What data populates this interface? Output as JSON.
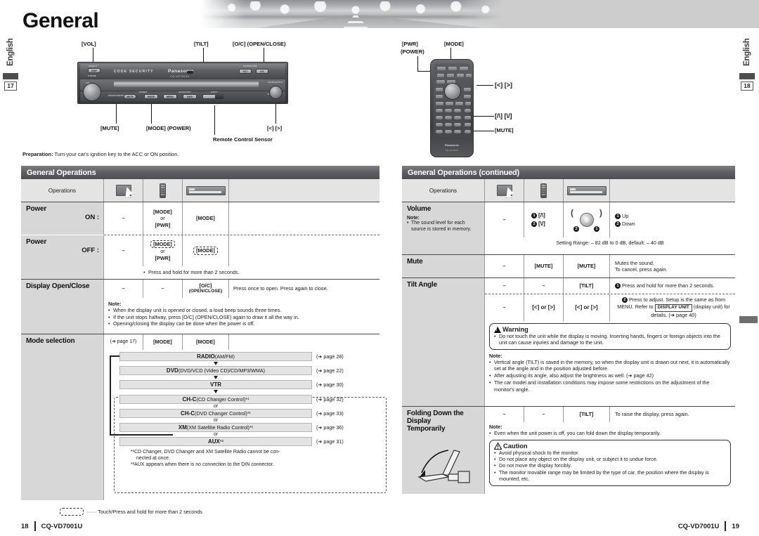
{
  "document": {
    "title": "General",
    "language_tab": "English",
    "left_page_number": "17",
    "right_page_number": "18",
    "footer_left_page": "18",
    "footer_left_model": "CQ-VD7001U",
    "footer_right_page": "19",
    "footer_right_model": "CQ-VD7001U"
  },
  "unit_callouts": {
    "vol": "[VOL]",
    "tilt": "[TILT]",
    "open_close": "[O/C] (OPEN/CLOSE)",
    "mute": "[MUTE]",
    "mode_power": "[MODE] (POWER)",
    "left_right": "[<] [>]",
    "remote_sensor": "Remote Control Sensor",
    "brand": "Panasonic",
    "model": "CQ-VD7001U",
    "code_security": "CODE SECURITY",
    "aspect": "ASPECT",
    "p_mode": "P-MODE",
    "disp": "DISP",
    "tilt_btn": "TILT",
    "oc_btn": "O/C",
    "open_close_small": "OPEN/CLOSE",
    "source_signal": "SOURCE/SIGNAL",
    "mute_btn": "MUTE",
    "power_small": "POWER",
    "mode_btn": "MODE",
    "menu_btn": "MENU",
    "navigator": "NAVIGATOR",
    "nav_btn": "NAVI",
    "eject": "EJECT",
    "vol_small": "VOL",
    "tune_track": "TUNE/TRACK",
    "enter": "ENTER",
    "band_auto": "BAND/AUTO.P"
  },
  "remote_callouts": {
    "pwr": "[PWR]",
    "power": "(POWER)",
    "mode": "[MODE]",
    "left_right": "[<] [>]",
    "up_down": "[/\\] [\\/]",
    "mute": "[MUTE]",
    "brand": "Panasonic",
    "model": "CQ-VD7001U"
  },
  "preparation": {
    "label": "Preparation:",
    "text": " Turn your car's ignition key to the ACC or ON position."
  },
  "left_section": {
    "header": "General Operations",
    "column_header": "Operations",
    "icons": [
      "touch-screen-icon",
      "remote-control-icon",
      "head-unit-icon"
    ],
    "rows": [
      {
        "title": "Power",
        "subtitle": "ON :",
        "touch": "–",
        "remote_line1": "[MODE]",
        "remote_or": "or",
        "remote_line2": "[PWR]",
        "unit": "[MODE]",
        "desc": ""
      },
      {
        "title": "Power",
        "subtitle": "OFF :",
        "touch": "–",
        "remote_line1": "[MODE]",
        "remote_or": "or",
        "remote_line2": "[PWR]",
        "unit": "[MODE]",
        "note": "Press and hold for more than 2 seconds."
      },
      {
        "title": "Display Open/Close",
        "subtitle": "",
        "touch": "–",
        "remote": "–",
        "unit_line1": "[O/C]",
        "unit_line2": "(OPEN/CLOSE)",
        "desc": "Press once to open. Press again to close.",
        "note_head": "Note:",
        "notes": [
          "When the display unit is opened or closed, a loud beep sounds three times.",
          "If the unit stops halfway, press [O/C] (OPEN/CLOSE) again to draw it all the way in.",
          "Opening/closing the display can be done when the power is off."
        ]
      },
      {
        "title": "Mode selection",
        "touch": "(➜ page 17)",
        "remote": "[MODE]",
        "unit": "[MODE]"
      }
    ],
    "mode_flow": [
      {
        "name": "RADIO",
        "detail": " (AM/FM)",
        "page": "(➜ page 28)"
      },
      {
        "name": "DVD",
        "detail": " (DVD/VCD (Video CD)/CD/MP3/WMA)",
        "page": "(➜ page 22)"
      },
      {
        "name": "VTR",
        "detail": "",
        "page": "(➜ page 30)"
      },
      {
        "name": "CH-C",
        "detail": " (CD Changer Control)*¹",
        "page": "(➜ page 32)"
      },
      {
        "name": "CH-C",
        "detail": " (DVD Changer Control)*¹",
        "page": "(➜ page 33)"
      },
      {
        "name": "XM",
        "detail": " (XM Satellite Radio Control)*¹",
        "page": "(➜ page 36)"
      },
      {
        "name": "AUX",
        "detail": "*²",
        "page": "(➜ page 31)"
      }
    ],
    "or_label": "or",
    "footnote1": "*¹CD Changer, DVD Changer and XM Satellite Radio cannot be con-",
    "footnote1b": "nected at once.",
    "footnote2": "*²AUX appears when there is no connection to the DIN connector.",
    "legend": "······ Touch/Press and hold for more than 2 seconds"
  },
  "right_section": {
    "header": "General Operations (continued)",
    "column_header": "Operations",
    "volume": {
      "title": "Volume",
      "note_head": "Note:",
      "note": "The sound level for each source is stored in memory.",
      "touch": "–",
      "remote_1": "[/\\]",
      "remote_2": "[\\/]",
      "desc_1": "Up",
      "desc_2": "Down",
      "range": "Setting Range: – 82 dB to 0 dB,  default: – 40 dB"
    },
    "mute": {
      "title": "Mute",
      "touch": "–",
      "remote": "[MUTE]",
      "unit": "[MUTE]",
      "desc_line1": "Mutes the sound.",
      "desc_line2": "To cancel, press again."
    },
    "tilt": {
      "title": "Tilt Angle",
      "row1": {
        "touch": "–",
        "remote": "–",
        "unit": "[TILT]",
        "desc": "Press and hold for more than 2 seconds."
      },
      "row2": {
        "touch": "–",
        "remote": "[<] or [>]",
        "unit": "[<] or [>]",
        "desc_a": "Press to adjust. Setup is the same as from MENU. Refer to",
        "desc_box": "DISPLAY UNIT",
        "desc_b": "(display unit) for details. (➜ page 40)"
      },
      "warning": {
        "title": "Warning",
        "items": [
          "Do not touch the unit while the display is moving. Inserting hands, fingers or foreign objects into the unit can cause injuries and damage to the unit."
        ]
      },
      "note_head": "Note:",
      "notes": [
        "Vertical angle (TILT) is saved in the memory, so when the display unit is drawn out next, it is automatically set at the angle and in the position adjusted before.",
        "After adjusting its angle, also adjust the brightness as well. (➜ page 42)",
        "The car model and installation conditions may impose some restrictions on the adjustment of the monitor's angle."
      ]
    },
    "folding": {
      "title_line1": "Folding Down the",
      "title_line2": "Display",
      "title_line3": "Temporarily",
      "touch": "–",
      "remote": "–",
      "unit": "[TILT]",
      "desc": "To raise the display, press again.",
      "note_head": "Note:",
      "note": "Even when the unit power is off, you can fold down the display temporarily.",
      "caution": {
        "title": "Caution",
        "items": [
          "Avoid physical shock to the monitor.",
          "Do not place any object on the display unit, or subject it to undue force.",
          "Do not move the display forcibly.",
          "The monitor movable range may be limited by the type of car, the position where the display is mounted, etc."
        ]
      }
    }
  }
}
